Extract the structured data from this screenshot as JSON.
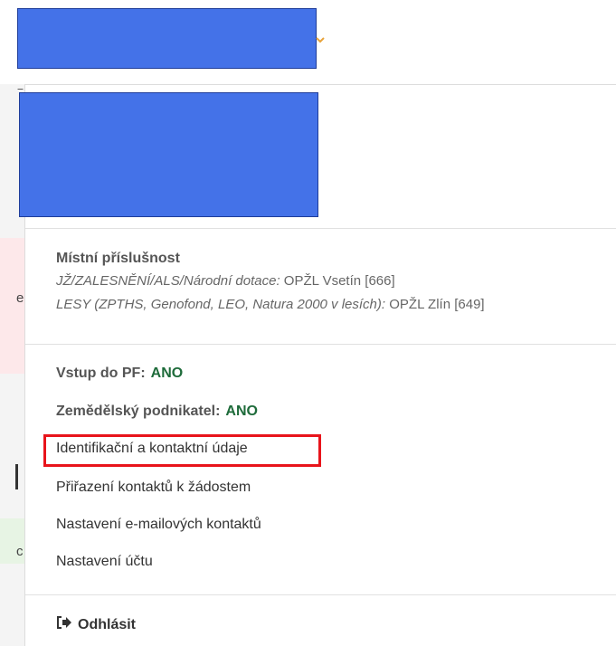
{
  "competence": {
    "title": "Místní příslušnost",
    "line1_label": "JŽ/ZALESNĚNÍ/ALS/Národní dotace:",
    "line1_value": "OPŽL Vsetín [666]",
    "line2_label": "LESY (ZPTHS, Genofond, LEO, Natura 2000 v lesích):",
    "line2_value": "OPŽL Zlín [649]"
  },
  "flags": {
    "pf_label": "Vstup do PF:",
    "pf_value": "ANO",
    "farmer_label": "Zemědělský podnikatel:",
    "farmer_value": "ANO"
  },
  "menu": {
    "identification": "Identifikační a kontaktní údaje",
    "assignment": "Přiřazení kontaktů k žádostem",
    "email_settings": "Nastavení e-mailových kontaktů",
    "account_settings": "Nastavení účtu",
    "logout": "Odhlásit"
  },
  "left_strip": {
    "mark1": "e",
    "mark2": "c"
  },
  "colors": {
    "redaction": "#4472e8",
    "highlight": "#e8141b",
    "yes_value": "#1e6b3a",
    "chevron": "#e8a33a"
  },
  "icons": {
    "chevron": "chevron-down-icon",
    "logout": "logout-icon"
  }
}
